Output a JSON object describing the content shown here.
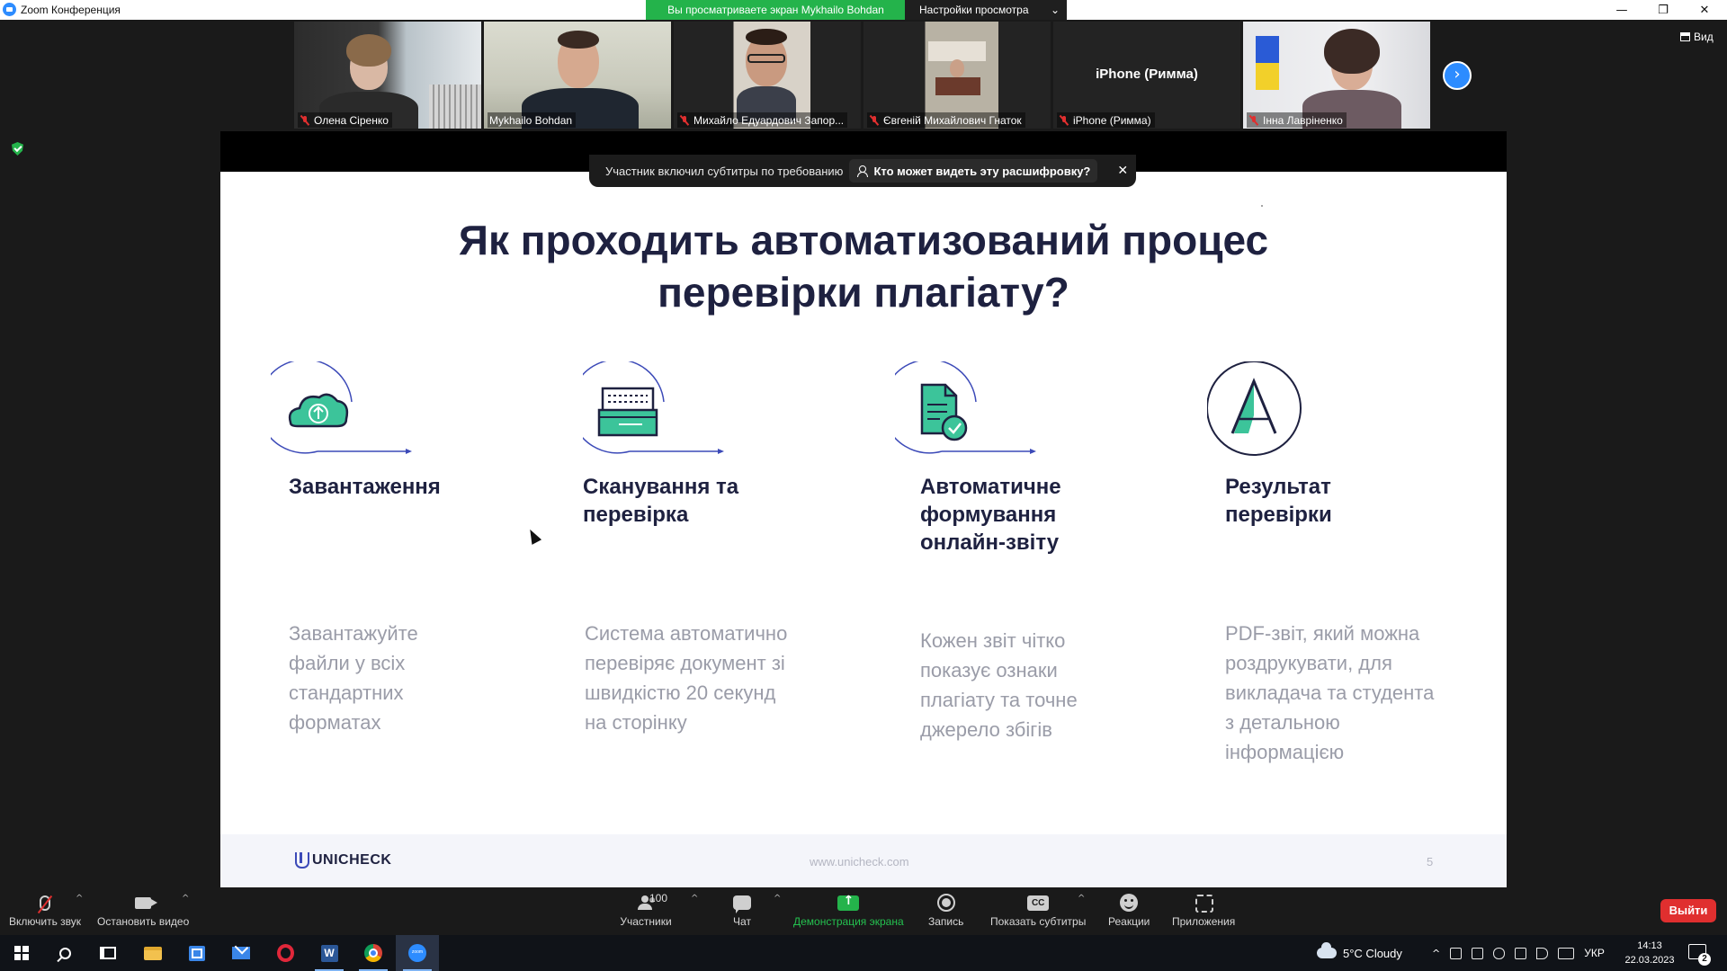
{
  "window": {
    "title": "Zoom Конференция"
  },
  "share_banner": {
    "viewing_text": "Вы просматриваете экран Mykhailo Bohdan",
    "view_settings_label": "Настройки просмотра"
  },
  "participants": [
    {
      "name": "Олена Сіренко",
      "muted": true,
      "video": true
    },
    {
      "name": "Mykhailo Bohdan",
      "muted": false,
      "video": true,
      "active_speaker": true
    },
    {
      "name": "Михайло Едуардович Запор...",
      "muted": true,
      "video": true
    },
    {
      "name": "Євгеній Михайлович Гнаток",
      "muted": true,
      "video": true
    },
    {
      "name": "iPhone (Римма)",
      "muted": true,
      "video": false,
      "display_name": "iPhone (Римма)"
    },
    {
      "name": "Інна Лавріненко",
      "muted": true,
      "video": true
    }
  ],
  "view_button_label": "Вид",
  "captions": {
    "notice": "Участник включил субтитры по требованию",
    "who_can_see": "Кто может видеть эту расшифровку?"
  },
  "slide": {
    "title_line1": "Як проходить автоматизований процес",
    "title_line2": "перевірки плагіату?",
    "steps": [
      {
        "icon": "cloud-upload-icon",
        "title_lines": [
          "Завантаження"
        ],
        "text_lines": [
          "Завантажуйте",
          "файли у всіх",
          "стандартних",
          "форматах"
        ]
      },
      {
        "icon": "scanner-icon",
        "title_lines": [
          "Сканування та",
          "перевірка"
        ],
        "text_lines": [
          "Система автоматично",
          "перевіряє документ зі",
          "швидкістю 20 секунд",
          "на сторінку"
        ]
      },
      {
        "icon": "document-check-icon",
        "title_lines": [
          "Автоматичне",
          "формування",
          "онлайн-звіту"
        ],
        "text_lines": [
          "Кожен звіт чітко",
          "показує ознаки",
          "плагіату та точне",
          "джерело збігів"
        ]
      },
      {
        "icon": "letter-a-icon",
        "title_lines": [
          "Результат",
          "перевірки"
        ],
        "text_lines": [
          "PDF-звіт, який можна",
          "роздрукувати, для",
          "викладача та студента",
          "з детальною",
          "інформацією"
        ]
      }
    ],
    "brand": "UNICHECK",
    "url": "www.unicheck.com",
    "page_number": "5"
  },
  "toolbar": {
    "unmute_label": "Включить звук",
    "stop_video_label": "Остановить видео",
    "participants_label": "Участники",
    "participants_count": "100",
    "chat_label": "Чат",
    "share_label": "Демонстрация экрана",
    "record_label": "Запись",
    "captions_label": "Показать субтитры",
    "captions_icon_text": "CC",
    "reactions_label": "Реакции",
    "apps_label": "Приложения",
    "leave_label": "Выйти"
  },
  "taskbar": {
    "weather": "5°C  Cloudy",
    "language": "УКР",
    "time": "14:13",
    "date": "22.03.2023",
    "notifications_count": "2",
    "word_icon_text": "W"
  },
  "colors": {
    "share_banner": "#24b34b",
    "slide_title": "#1e2140",
    "slide_body": "#9a9ca8",
    "icon_teal": "#3cc49a",
    "icon_stroke": "#3c4ab8",
    "leave_red": "#e02f2f",
    "zoom_blue": "#2d8cff"
  }
}
